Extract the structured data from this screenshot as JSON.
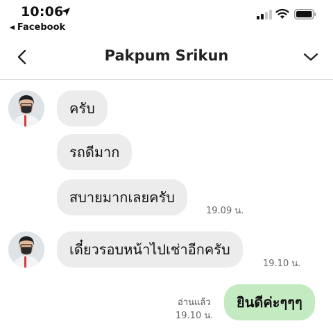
{
  "status_bar": {
    "time": "10:06",
    "back_app": "Facebook",
    "back_arrow": "◀"
  },
  "header": {
    "title": "Pakpum Srikun"
  },
  "messages": [
    {
      "text": "ครับ"
    },
    {
      "text": "รถดีมาก"
    },
    {
      "text": "สบายมากเลยครับ",
      "time": "19.09 น."
    },
    {
      "text": "เดี๋ยวรอบหน้าไปเช่าอีกครับ",
      "time": "19.10 น."
    },
    {
      "text": "ยินดีค่ะๆๆๆ",
      "read_label": "อ่านแล้ว",
      "time": "19.10 น."
    }
  ],
  "colors": {
    "incoming_bubble": "#ececec",
    "outgoing_bubble": "#c4eac1",
    "timestamp": "#666666"
  },
  "icons": {
    "location": "location-arrow-icon",
    "signal": "cellular-signal-icon",
    "wifi": "wifi-icon",
    "battery": "battery-icon",
    "back": "chevron-left-icon",
    "more": "chevron-down-icon"
  }
}
